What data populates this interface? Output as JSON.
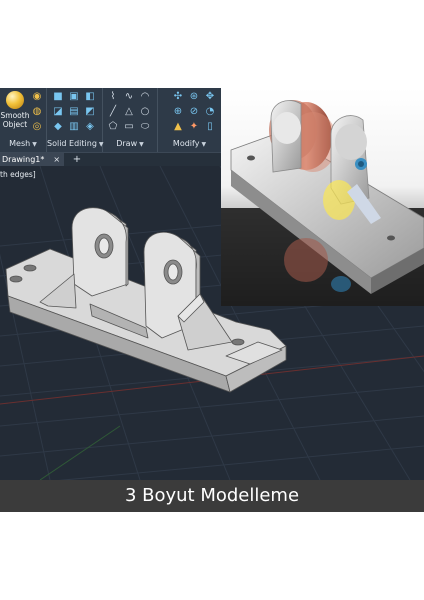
{
  "ribbon": {
    "groups": [
      {
        "id": "mesh",
        "label": "Mesh",
        "has_dropdown": true,
        "big_button": {
          "label_line1": "Smooth",
          "label_line2": "Object"
        }
      },
      {
        "id": "solid-editing",
        "label": "Solid Editing",
        "has_dropdown": true
      },
      {
        "id": "draw",
        "label": "Draw",
        "has_dropdown": true
      },
      {
        "id": "modify",
        "label": "Modify",
        "has_dropdown": true
      }
    ]
  },
  "tabs": {
    "active_doc": "Drawing1*",
    "close_glyph": "×",
    "new_tab_glyph": "+"
  },
  "viewport": {
    "visual_style_label": "th edges]"
  },
  "caption": "3 Boyut Modelleme",
  "icons": [
    "smooth-object-icon",
    "close-icon",
    "plus-icon",
    "dropdown-caret-icon"
  ],
  "colors": {
    "ribbon_bg": "#2e3a48",
    "viewport_bg": "#232b36",
    "model_light": "#d8d8d8",
    "caption_bg": "#3b3b3b",
    "bearing": "#c8705d"
  }
}
